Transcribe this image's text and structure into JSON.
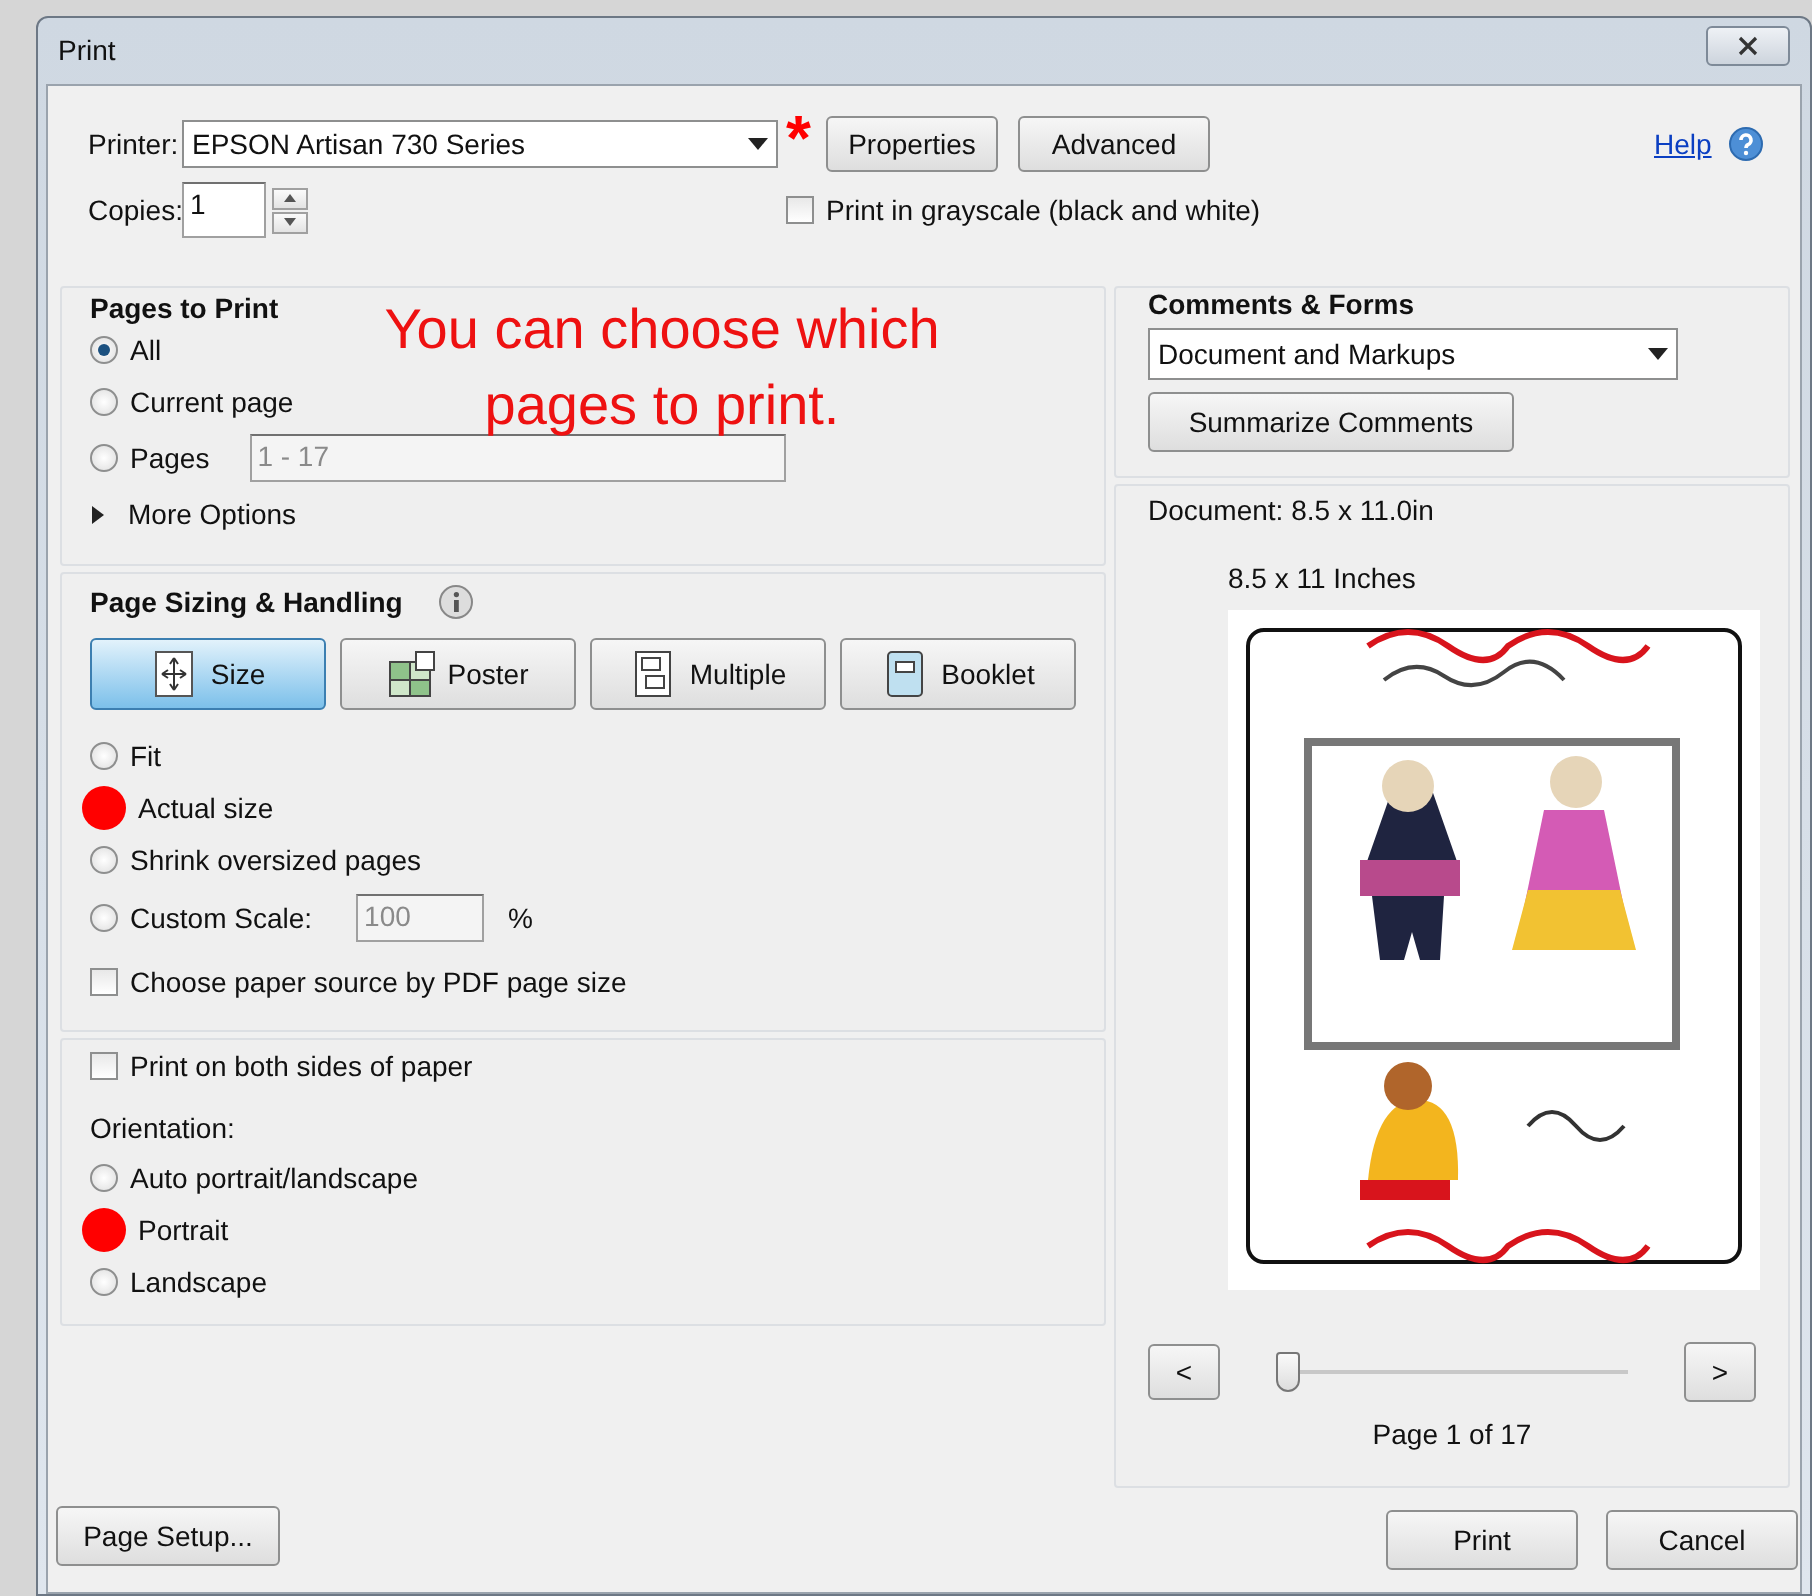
{
  "window": {
    "title": "Print"
  },
  "printer": {
    "label": "Printer:",
    "value": "EPSON Artisan 730 Series"
  },
  "annotation_mark": "*",
  "properties_button": "Properties",
  "advanced_button": "Advanced",
  "help_link": "Help",
  "copies": {
    "label": "Copies:",
    "value": "1"
  },
  "grayscale": {
    "label": "Print in grayscale (black and white)",
    "checked": false
  },
  "pages_to_print": {
    "title": "Pages to Print",
    "options": [
      {
        "label": "All",
        "selected": true
      },
      {
        "label": "Current page",
        "selected": false
      },
      {
        "label": "Pages",
        "selected": false
      }
    ],
    "pages_field": "1 - 17",
    "more_options": {
      "label": "More Options",
      "expanded": false
    }
  },
  "annotation": "You can choose which pages to print.",
  "page_sizing": {
    "title": "Page Sizing & Handling",
    "modes": [
      {
        "label": "Size",
        "selected": true
      },
      {
        "label": "Poster",
        "selected": false
      },
      {
        "label": "Multiple",
        "selected": false
      },
      {
        "label": "Booklet",
        "selected": false
      }
    ],
    "options": [
      {
        "label": "Fit",
        "marked": false
      },
      {
        "label": "Actual size",
        "marked": true
      },
      {
        "label": "Shrink oversized pages",
        "marked": false
      },
      {
        "label": "Custom Scale:",
        "marked": false
      }
    ],
    "scale_field": "100",
    "percent": "%",
    "paper_source": {
      "label": "Choose paper source by PDF page size",
      "checked": false
    }
  },
  "duplex": {
    "label": "Print on both sides of paper",
    "checked": false
  },
  "orientation": {
    "title": "Orientation:",
    "options": [
      {
        "label": "Auto portrait/landscape",
        "marked": false
      },
      {
        "label": "Portrait",
        "marked": true
      },
      {
        "label": "Landscape",
        "marked": false
      }
    ]
  },
  "page_setup_button": "Page Setup...",
  "comments_forms": {
    "title": "Comments & Forms",
    "value": "Document and Markups",
    "summarize_button": "Summarize Comments"
  },
  "preview": {
    "document_size": "Document: 8.5 x 11.0in",
    "paper_size": "8.5 x 11 Inches",
    "kind": "picture",
    "prev_button": "<",
    "next_button": ">",
    "slider": {
      "level": 0.0
    },
    "page_label": "Page 1 of 17"
  },
  "print_button": "Print",
  "cancel_button": "Cancel"
}
